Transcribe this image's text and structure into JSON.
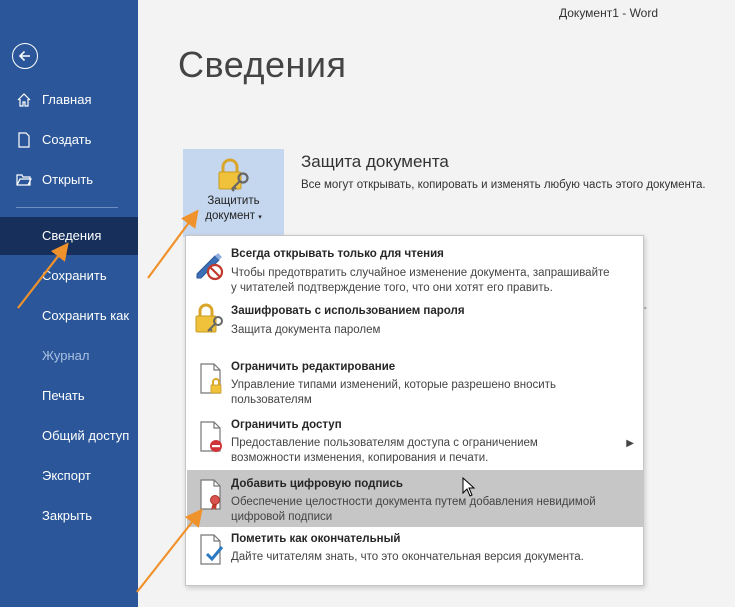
{
  "window": {
    "title": "Документ1  -  Word"
  },
  "sidebar": {
    "back_icon": "back-arrow-icon",
    "items": [
      {
        "label": "Главная",
        "icon": "home-icon"
      },
      {
        "label": "Создать",
        "icon": "new-document-icon"
      },
      {
        "label": "Открыть",
        "icon": "folder-open-icon"
      },
      {
        "label": "Сведения"
      },
      {
        "label": "Сохранить"
      },
      {
        "label": "Сохранить как"
      },
      {
        "label": "Журнал"
      },
      {
        "label": "Печать"
      },
      {
        "label": "Общий доступ"
      },
      {
        "label": "Экспорт"
      },
      {
        "label": "Закрыть"
      }
    ],
    "active_item": "Сведения",
    "disabled_item": "Журнал"
  },
  "main": {
    "heading": "Сведения",
    "protect_button": {
      "line1": "Защитить",
      "line2": "документ",
      "icon": "lock-key-icon"
    },
    "section_title": "Защита документа",
    "section_desc": "Все могут открывать, копировать и изменять любую часть этого документа."
  },
  "menu": {
    "items": [
      {
        "title": "Всегда открывать только для чтения",
        "desc1": "Чтобы предотвратить случайное изменение документа, запрашивайте",
        "desc2": "у читателей подтверждение того, что они хотят его править.",
        "icon": "pencil-no-icon"
      },
      {
        "title": "Зашифровать с использованием пароля",
        "desc1": "Защита документа паролем",
        "icon": "lock-key-icon"
      },
      {
        "title": "Ограничить редактирование",
        "desc1": "Управление типами изменений, которые разрешено вносить",
        "desc2": "пользователям",
        "icon": "document-lock-icon"
      },
      {
        "title": "Ограничить доступ",
        "desc1": "Предоставление пользователям доступа с ограничением",
        "desc2": "возможности изменения, копирования и печати.",
        "icon": "document-restricted-icon"
      },
      {
        "title": "Добавить цифровую подпись",
        "desc1": "Обеспечение целостности документа путем добавления невидимой",
        "desc2": "цифровой подписи",
        "icon": "document-ribbon-icon"
      },
      {
        "title": "Пометить как окончательный",
        "desc1": "Дайте читателям знать, что это окончательная версия документа.",
        "icon": "document-check-icon"
      }
    ],
    "highlighted": "Добавить цифровую подпись"
  },
  "colors": {
    "sidebar": "#2b579a",
    "sidebar_active": "#16305b",
    "accent_arrow": "#f0922b",
    "highlight": "#c6c6c6"
  }
}
